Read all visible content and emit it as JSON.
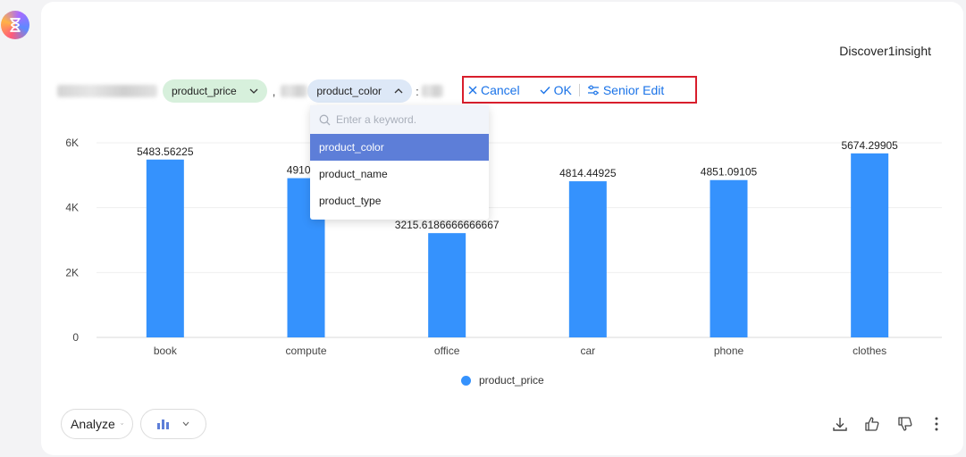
{
  "card": {
    "title": "Discover1insight"
  },
  "query": {
    "measure_chip": "product_price",
    "separator": ",",
    "dimension_chip": "product_color",
    "tail": ":"
  },
  "actions": {
    "cancel": "Cancel",
    "ok": "OK",
    "senior_edit": "Senior Edit"
  },
  "dropdown": {
    "placeholder": "Enter a keyword.",
    "options": [
      "product_color",
      "product_name",
      "product_type"
    ],
    "selected": "product_color"
  },
  "bottom": {
    "analyze_label": "Analyze"
  },
  "colors": {
    "bar": "#3592fd",
    "accent": "#1a73e8",
    "highlight_border": "#d81e2c"
  },
  "chart_data": {
    "type": "bar",
    "categories": [
      "book",
      "compute",
      "office",
      "car",
      "phone",
      "clothes"
    ],
    "series": [
      {
        "name": "product_price",
        "values": [
          5483.56225,
          4910.24,
          3215.6186666666667,
          4814.44925,
          4851.09105,
          5674.29905
        ],
        "labels": [
          "5483.56225",
          "4910.24",
          "3215.6186666666667",
          "4814.44925",
          "4851.09105",
          "5674.29905"
        ]
      }
    ],
    "yticks": [
      "0",
      "2K",
      "4K",
      "6K"
    ],
    "ylim": [
      0,
      6000
    ],
    "grid": true,
    "legend": "bottom-center"
  }
}
